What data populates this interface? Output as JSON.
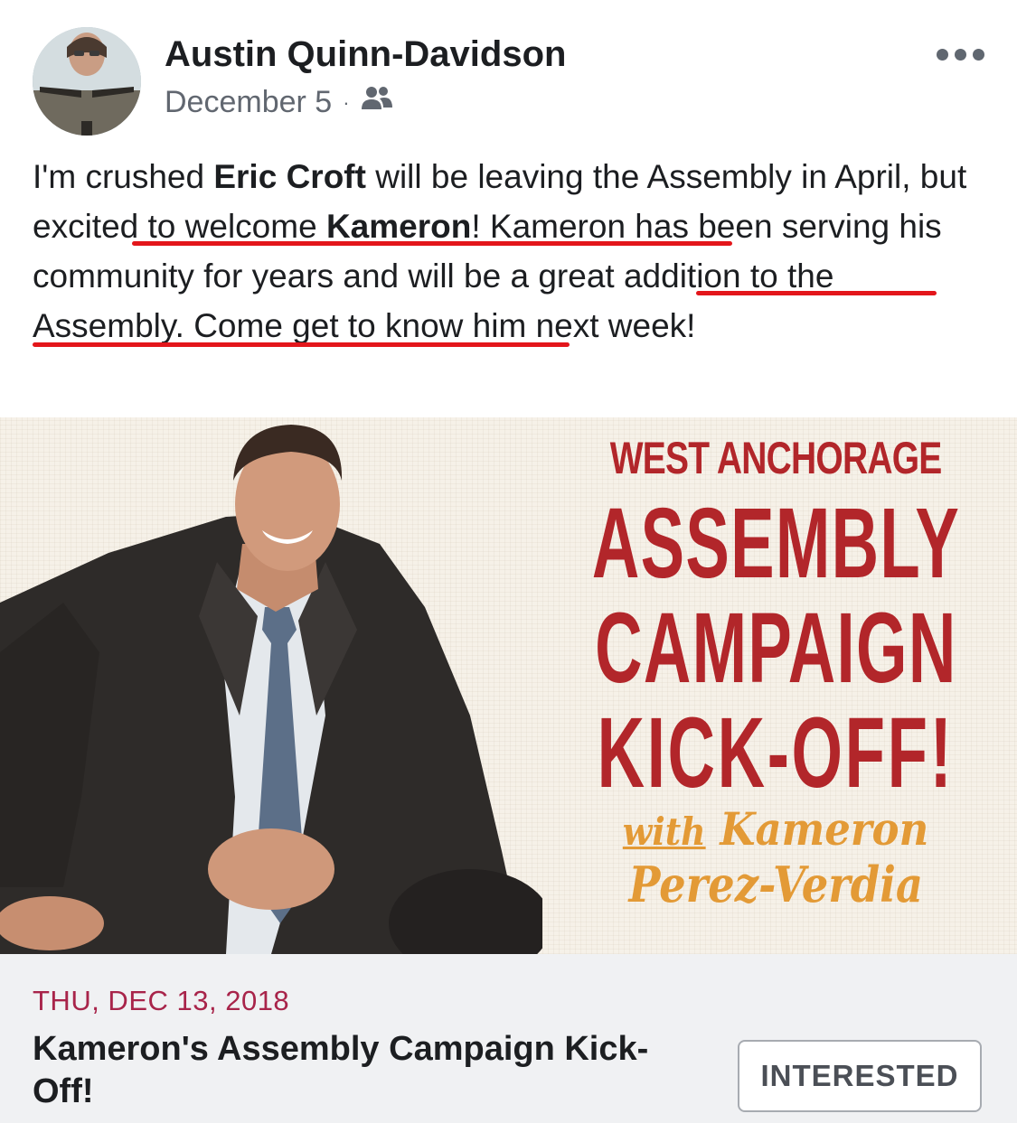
{
  "post": {
    "author": "Austin Quinn-Davidson",
    "date": "December 5",
    "separator": "·",
    "audience_icon": "friends-icon",
    "more_icon": "more-options-icon",
    "text": {
      "s1": "I'm crushed ",
      "b1": "Eric Croft",
      "s2": " will be leaving the Assembly in April, ",
      "s3": "but excited to welcome ",
      "b2": "Kameron",
      "s4": "! Kameron has been serving his community for years ",
      "s5": "and will be a great addition to the Assembly",
      "s6": ". Come get to know him next week!"
    },
    "annotation_color": "#e3161b"
  },
  "promo": {
    "line1": "WEST ANCHORAGE",
    "line2": "ASSEMBLY",
    "line3": "CAMPAIGN",
    "line4": "KICK-OFF!",
    "with": "with",
    "name1": "Kameron",
    "name2": "Perez-Verdia",
    "title_color": "#b2262a",
    "name_color": "#e39a36"
  },
  "event": {
    "date": "THU, DEC 13, 2018",
    "title": "Kameron's Assembly Campaign Kick-Off!",
    "button_label": "INTERESTED"
  }
}
